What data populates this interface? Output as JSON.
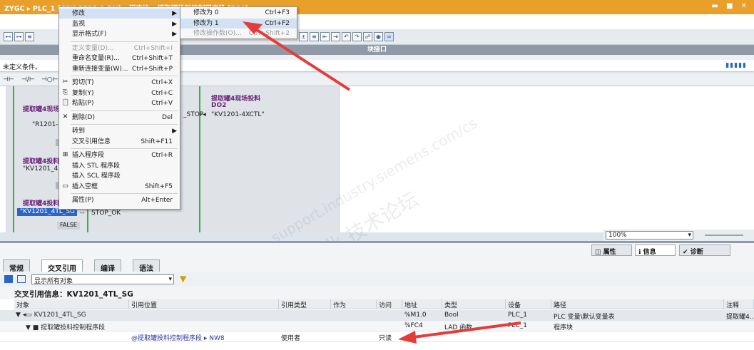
{
  "titlebar": {
    "title": "ZYGC ▸ PLC_1 [CPU 1513-1 PN] ▸ 程序块 ▸ 提取罐投料控制程序段 [FC4]",
    "controls": "▬ ■ ✕"
  },
  "toolbar": {
    "block_interface_label": "块接口"
  },
  "condition_row": {
    "text": "未定义条件。"
  },
  "ladder_elems": [
    "⊣⊢",
    "⊣/⊢",
    "⊣○⊢"
  ],
  "network": {
    "labels_purple": [
      "提取罐4现场",
      "提取罐4投料",
      "提取罐4投料"
    ],
    "vars": [
      "\"R1201-",
      "\"KV1201_4",
      "\"KV1201_4TL_SG\""
    ],
    "stop_ok": "STOP_OK",
    "false_label": "FALSE",
    "right_title": "提取罐4现场投料",
    "right_do": "DO2",
    "right_stop": "_STOP",
    "right_var": "\"KV1201-4XCTL\""
  },
  "watermark": {
    "line1": "西门子工业 技术论坛",
    "line2": "support.industry.siemens.com/cs"
  },
  "context_menu": [
    {
      "icon": "",
      "label": "修改",
      "shortcut": "",
      "arrow": "▶",
      "disabled": false,
      "highlight": true
    },
    {
      "icon": "",
      "label": "监视",
      "shortcut": "",
      "arrow": "▶",
      "disabled": false
    },
    {
      "icon": "",
      "label": "显示格式(F)",
      "shortcut": "",
      "arrow": "▶",
      "disabled": false
    },
    {
      "sep": true
    },
    {
      "icon": "",
      "label": "定义变量(D)...",
      "shortcut": "Ctrl+Shift+I",
      "disabled": true
    },
    {
      "icon": "",
      "label": "重命名变量(R)...",
      "shortcut": "Ctrl+Shift+T",
      "disabled": false
    },
    {
      "icon": "",
      "label": "重新连接变量(W)...",
      "shortcut": "Ctrl+Shift+P",
      "disabled": false
    },
    {
      "sep": true
    },
    {
      "icon": "✂",
      "label": "剪切(T)",
      "shortcut": "Ctrl+X",
      "disabled": false
    },
    {
      "icon": "⎘",
      "label": "复制(Y)",
      "shortcut": "Ctrl+C",
      "disabled": false
    },
    {
      "icon": "📋",
      "label": "粘贴(P)",
      "shortcut": "Ctrl+V",
      "disabled": false
    },
    {
      "sep": true
    },
    {
      "icon": "✕",
      "label": "删除(D)",
      "shortcut": "Del",
      "disabled": false
    },
    {
      "sep": true
    },
    {
      "icon": "",
      "label": "转到",
      "shortcut": "",
      "arrow": "▶",
      "disabled": false
    },
    {
      "icon": "",
      "label": "交叉引用信息",
      "shortcut": "Shift+F11",
      "disabled": false
    },
    {
      "sep": true
    },
    {
      "icon": "⊞",
      "label": "插入程序段",
      "shortcut": "Ctrl+R",
      "disabled": false
    },
    {
      "icon": "",
      "label": "插入 STL 程序段",
      "shortcut": "",
      "disabled": false
    },
    {
      "icon": "",
      "label": "插入 SCL 程序段",
      "shortcut": "",
      "disabled": false
    },
    {
      "icon": "▭",
      "label": "插入空框",
      "shortcut": "Shift+F5",
      "disabled": false
    },
    {
      "sep": true
    },
    {
      "icon": "",
      "label": "属性(P)",
      "shortcut": "Alt+Enter",
      "disabled": false
    }
  ],
  "submenu": [
    {
      "label": "修改为 0",
      "shortcut": "Ctrl+F3",
      "disabled": false,
      "highlight": false
    },
    {
      "label": "修改为 1",
      "shortcut": "Ctrl+F2",
      "disabled": false,
      "highlight": true
    },
    {
      "label": "修改操作数(O)...",
      "shortcut": "Ctrl+Shift+2",
      "disabled": true,
      "highlight": false
    }
  ],
  "zoom": {
    "value": "100%"
  },
  "inspector_tabs": [
    {
      "icon": "◫",
      "label": "属性"
    },
    {
      "icon": "ℹ",
      "label": "信息",
      "active": true
    },
    {
      "icon": "✔",
      "label": "诊断"
    }
  ],
  "subtabs": [
    {
      "label": "常规"
    },
    {
      "label": "交叉引用",
      "active": true
    },
    {
      "label": "编译"
    },
    {
      "label": "语法"
    }
  ],
  "filter": {
    "value": "显示所有对象"
  },
  "xref_title": "交叉引用信息：KV1201_4TL_SG",
  "columns": [
    "对象",
    "引用位置",
    "引用类型",
    "作为",
    "访问",
    "地址",
    "类型",
    "设备",
    "路径",
    "注释"
  ],
  "rows": [
    {
      "obj": "▼ ◂▭ KV1201_4TL_SG",
      "loc": "",
      "rtype": "",
      "as": "",
      "access": "",
      "addr": "%M1.0",
      "type": "Bool",
      "dev": "PLC_1",
      "path": "PLC 变量\\默认变量表",
      "comment": "提取罐4..."
    },
    {
      "obj": "▼ ■ 提取罐投料控制程序段",
      "loc": "",
      "rtype": "",
      "as": "",
      "access": "",
      "addr": "%FC4",
      "type": "LAD 函数",
      "dev": "PLC_1",
      "path": "程序块",
      "comment": ""
    },
    {
      "obj": "",
      "loc": "@提取罐投料控制程序段 ▸ NW8",
      "rtype": "使用者",
      "as": "",
      "access": "只读",
      "addr": "",
      "type": "",
      "dev": "",
      "path": "",
      "comment": ""
    }
  ],
  "colors": {
    "title_orange": "#e9a02a",
    "accent_red": "#e63b3b",
    "rail_green": "#38b048",
    "purple": "#6b2378"
  }
}
